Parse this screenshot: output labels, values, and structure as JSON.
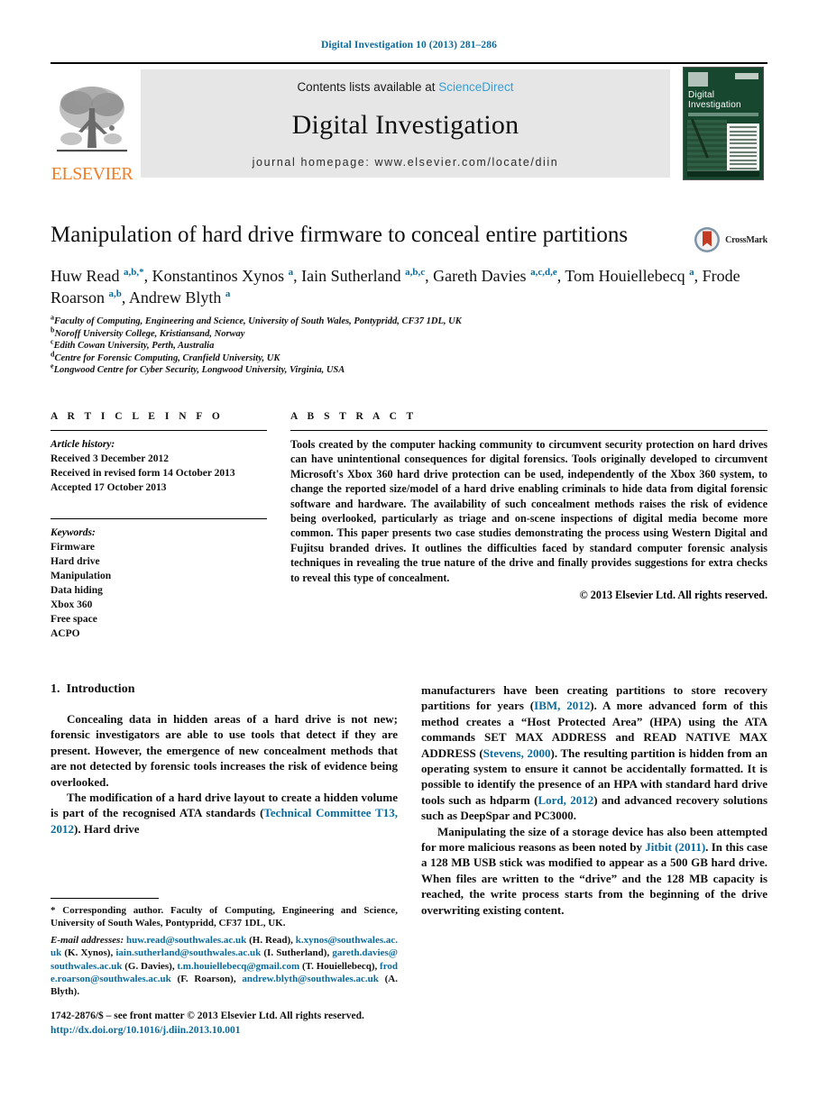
{
  "running_head": "Digital Investigation 10 (2013) 281–286",
  "banner": {
    "publisher_wordmark": "ELSEVIER",
    "contents_prefix": "Contents lists available at ",
    "contents_link": "ScienceDirect",
    "journal_title": "Digital Investigation",
    "homepage": "journal homepage: www.elsevier.com/locate/diin",
    "cover": {
      "line1": "Digital",
      "line2": "Investigation"
    }
  },
  "article": {
    "title": "Manipulation of hard drive firmware to conceal entire partitions",
    "crossmark_label": "CrossMark",
    "authors_html": "Huw Read <sup>a,b,*</sup>, Konstantinos Xynos <sup>a</sup>, Iain Sutherland <sup>a,b,c</sup>, Gareth Davies <sup>a,c,d,e</sup>, Tom Houiellebecq <sup>a</sup>, Frode Roarson <sup>a,b</sup>, Andrew Blyth <sup>a</sup>",
    "affiliations": [
      {
        "marker": "a",
        "text": "Faculty of Computing, Engineering and Science, University of South Wales, Pontypridd, CF37 1DL, UK"
      },
      {
        "marker": "b",
        "text": "Noroff University College, Kristiansand, Norway"
      },
      {
        "marker": "c",
        "text": "Edith Cowan University, Perth, Australia"
      },
      {
        "marker": "d",
        "text": "Centre for Forensic Computing, Cranfield University, UK"
      },
      {
        "marker": "e",
        "text": "Longwood Centre for Cyber Security, Longwood University, Virginia, USA"
      }
    ]
  },
  "article_info": {
    "heading": "A R T I C L E   I N F O",
    "history_label": "Article history:",
    "history": [
      "Received 3 December 2012",
      "Received in revised form 14 October 2013",
      "Accepted 17 October 2013"
    ],
    "keywords_label": "Keywords:",
    "keywords": [
      "Firmware",
      "Hard drive",
      "Manipulation",
      "Data hiding",
      "Xbox 360",
      "Free space",
      "ACPO"
    ]
  },
  "abstract": {
    "heading": "A B S T R A C T",
    "text": "Tools created by the computer hacking community to circumvent security protection on hard drives can have unintentional consequences for digital forensics. Tools originally developed to circumvent Microsoft's Xbox 360 hard drive protection can be used, independently of the Xbox 360 system, to change the reported size/model of a hard drive enabling criminals to hide data from digital forensic software and hardware. The availability of such concealment methods raises the risk of evidence being overlooked, particularly as triage and on-scene inspections of digital media become more common. This paper presents two case studies demonstrating the process using Western Digital and Fujitsu branded drives. It outlines the difficulties faced by standard computer forensic analysis techniques in revealing the true nature of the drive and finally provides suggestions for extra checks to reveal this type of concealment.",
    "copyright": "© 2013 Elsevier Ltd. All rights reserved."
  },
  "body": {
    "section_number": "1.",
    "section_title": "Introduction",
    "left_p1": "Concealing data in hidden areas of a hard drive is not new; forensic investigators are able to use tools that detect if they are present. However, the emergence of new concealment methods that are not detected by forensic tools increases the risk of evidence being overlooked.",
    "left_p2_a": "The modification of a hard drive layout to create a hidden volume is part of the recognised ATA standards (",
    "left_p2_cit": "Technical Committee T13, 2012",
    "left_p2_b": "). Hard drive",
    "right_p1_a": "manufacturers have been creating partitions to store recovery partitions for years (",
    "right_p1_cit1": "IBM, 2012",
    "right_p1_b": "). A more advanced form of this method creates a “Host Protected Area” (HPA) using the ATA commands SET MAX ADDRESS and READ NATIVE MAX ADDRESS (",
    "right_p1_cit2": "Stevens, 2000",
    "right_p1_c": "). The resulting partition is hidden from an operating system to ensure it cannot be accidentally formatted. It is possible to identify the presence of an HPA with standard hard drive tools such as hdparm (",
    "right_p1_cit3": "Lord, 2012",
    "right_p1_d": ") and advanced recovery solutions such as DeepSpar and PC3000.",
    "right_p2_a": "Manipulating the size of a storage device has also been attempted for more malicious reasons as been noted by ",
    "right_p2_cit1": "Jitbit (2011)",
    "right_p2_b": ". In this case a 128 MB USB stick was modified to appear as a 500 GB hard drive. When files are written to the “drive” and the 128 MB capacity is reached, the write process starts from the beginning of the drive overwriting existing content."
  },
  "footnote": {
    "corresponding": "* Corresponding author. Faculty of Computing, Engineering and Science, University of South Wales, Pontypridd, CF37 1DL, UK.",
    "email_label": "E-mail addresses:",
    "emails": [
      {
        "address": "huw.read@southwales.ac.uk",
        "person": " (H. Read), "
      },
      {
        "address": "k.xynos@southwales.ac.uk",
        "person": " (K. Xynos), "
      },
      {
        "address": "iain.sutherland@southwales.ac.uk",
        "person": " (I. Sutherland), "
      },
      {
        "address": "gareth.davies@southwales.ac.uk",
        "person": " (G. Davies), "
      },
      {
        "address": "t.m.houiellebecq@gmail.com",
        "person": " (T. Houiellebecq), "
      },
      {
        "address": "frode.roarson@southwales.ac.uk",
        "person": " (F. Roarson), "
      },
      {
        "address": "andrew.blyth@southwales.ac.uk",
        "person": " (A. Blyth)."
      }
    ]
  },
  "colophon": {
    "front_matter": "1742-2876/$ – see front matter © 2013 Elsevier Ltd. All rights reserved.",
    "doi": "http://dx.doi.org/10.1016/j.diin.2013.10.001"
  },
  "colors": {
    "link_blue": "#0b6a9c",
    "sciencedirect_blue": "#3a9fd4",
    "elsevier_orange": "#ef7d22",
    "cover_green": "#17472f",
    "crossmark_red": "#c23b22"
  }
}
